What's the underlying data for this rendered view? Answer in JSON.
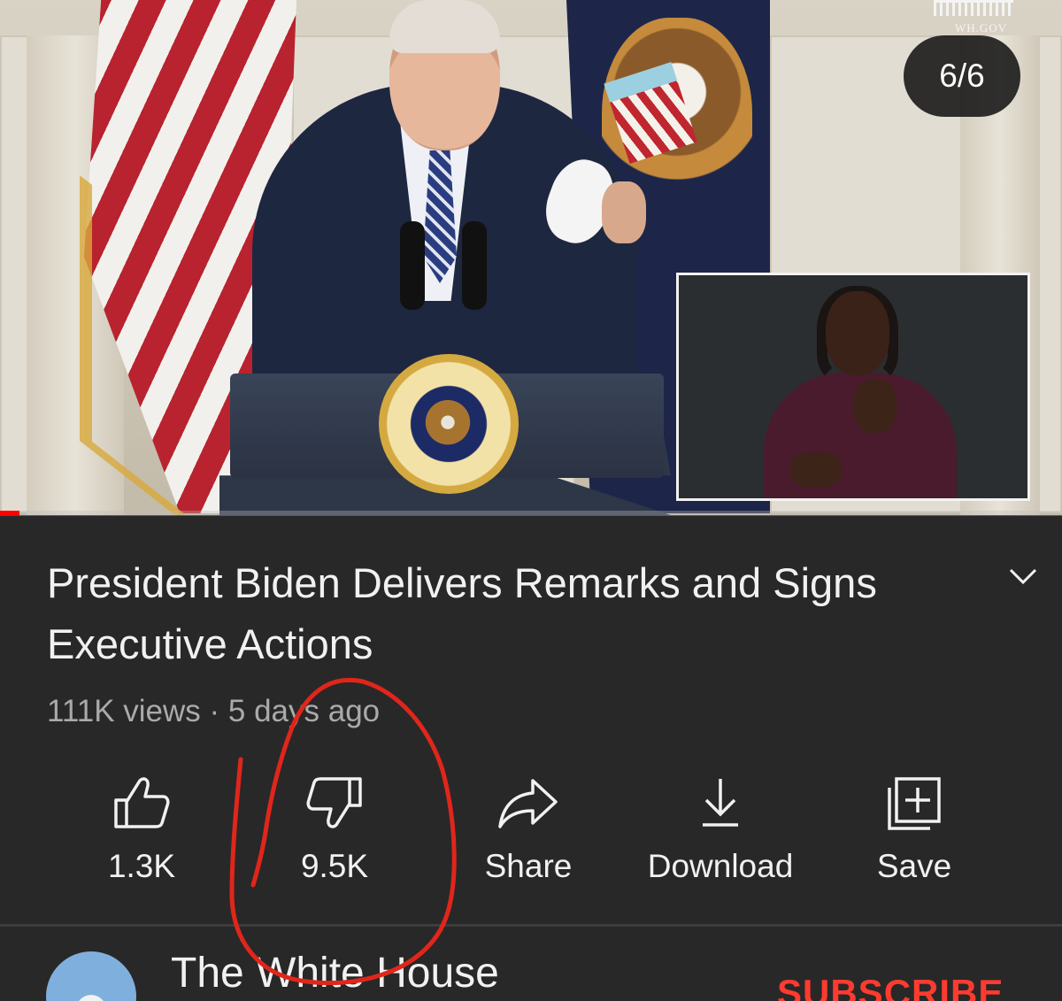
{
  "video": {
    "watermark": "WH.GOV",
    "image_counter": "6/6",
    "progress_fraction": 0.018
  },
  "details": {
    "title": "President Biden Delivers Remarks and Signs Executive Actions",
    "meta": "111K views · 5 days ago"
  },
  "actions": {
    "like_count": "1.3K",
    "dislike_count": "9.5K",
    "share_label": "Share",
    "download_label": "Download",
    "save_label": "Save"
  },
  "channel": {
    "name": "The White House",
    "subscribe_label": "SUBSCRIBE"
  },
  "colors": {
    "background": "#282828",
    "progress": "#ff0000",
    "subscribe": "#ff3b30",
    "annotation": "#e0261b"
  }
}
